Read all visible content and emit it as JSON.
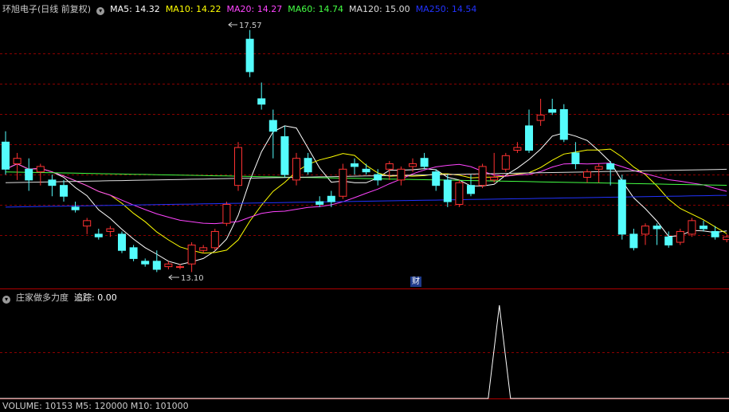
{
  "header": {
    "title": "环旭电子(日线 前复权)",
    "ma": [
      {
        "label": "MA5: 14.32",
        "color": "#ffffff"
      },
      {
        "label": "MA10: 14.22",
        "color": "#ffff00"
      },
      {
        "label": "MA20: 14.27",
        "color": "#ff44ff"
      },
      {
        "label": "MA60: 14.74",
        "color": "#44ff44"
      },
      {
        "label": "MA120: 15.00",
        "color": "#dddddd"
      },
      {
        "label": "MA250: 14.54",
        "color": "#2233ff"
      }
    ]
  },
  "annotations": {
    "high": "17.57",
    "low": "13.10",
    "finance_marker": "财"
  },
  "indicator": {
    "name": "庄家做多力度",
    "track_label": "追踪: 0.00"
  },
  "volume": {
    "label": "VOLUME: 10153  M5: 120000  M10: 101000"
  },
  "colors": {
    "up": "#ff3232",
    "down": "#54fcfc",
    "grid": "#8b0000",
    "frame": "#b00000"
  },
  "chart_data": {
    "type": "candlestick",
    "price_range": [
      12.9,
      17.8
    ],
    "ohlc": [
      [
        15.5,
        15.7,
        14.9,
        15.0
      ],
      [
        15.1,
        15.3,
        14.8,
        15.2
      ],
      [
        15.0,
        15.2,
        14.6,
        14.8
      ],
      [
        14.95,
        15.1,
        14.7,
        15.05
      ],
      [
        14.8,
        14.9,
        14.5,
        14.7
      ],
      [
        14.7,
        14.8,
        14.4,
        14.5
      ],
      [
        14.3,
        14.4,
        14.2,
        14.25
      ],
      [
        13.95,
        14.1,
        13.8,
        14.05
      ],
      [
        13.8,
        13.9,
        13.7,
        13.75
      ],
      [
        13.85,
        13.95,
        13.75,
        13.9
      ],
      [
        13.8,
        13.85,
        13.45,
        13.5
      ],
      [
        13.55,
        13.6,
        13.3,
        13.35
      ],
      [
        13.3,
        13.35,
        13.2,
        13.25
      ],
      [
        13.3,
        13.5,
        13.1,
        13.15
      ],
      [
        13.2,
        13.3,
        13.15,
        13.25
      ],
      [
        13.2,
        13.25,
        13.15,
        13.2
      ],
      [
        13.25,
        13.65,
        13.1,
        13.6
      ],
      [
        13.5,
        13.6,
        13.45,
        13.55
      ],
      [
        13.55,
        13.9,
        13.5,
        13.85
      ],
      [
        14.0,
        14.4,
        13.95,
        14.35
      ],
      [
        14.7,
        15.5,
        14.6,
        15.4
      ],
      [
        17.4,
        17.57,
        16.7,
        16.8
      ],
      [
        16.3,
        16.6,
        16.1,
        16.2
      ],
      [
        15.9,
        16.1,
        15.2,
        15.7
      ],
      [
        15.6,
        15.8,
        14.85,
        14.9
      ],
      [
        14.8,
        15.3,
        14.7,
        15.2
      ],
      [
        15.2,
        15.3,
        14.9,
        14.95
      ],
      [
        14.4,
        14.5,
        14.3,
        14.35
      ],
      [
        14.5,
        14.6,
        14.3,
        14.4
      ],
      [
        14.5,
        15.1,
        14.45,
        15.0
      ],
      [
        15.1,
        15.2,
        14.9,
        15.05
      ],
      [
        15.0,
        15.1,
        14.9,
        14.95
      ],
      [
        14.9,
        15.0,
        14.7,
        14.8
      ],
      [
        15.0,
        15.15,
        14.8,
        15.1
      ],
      [
        14.8,
        15.05,
        14.7,
        15.0
      ],
      [
        15.05,
        15.2,
        14.95,
        15.1
      ],
      [
        15.2,
        15.3,
        15.0,
        15.05
      ],
      [
        14.95,
        15.0,
        14.6,
        14.7
      ],
      [
        14.8,
        14.9,
        14.3,
        14.4
      ],
      [
        14.35,
        14.8,
        14.3,
        14.75
      ],
      [
        14.7,
        14.9,
        14.5,
        14.55
      ],
      [
        14.7,
        15.1,
        14.65,
        15.05
      ],
      [
        14.8,
        15.3,
        14.75,
        14.85
      ],
      [
        15.0,
        15.3,
        14.95,
        15.25
      ],
      [
        15.35,
        15.5,
        15.3,
        15.4
      ],
      [
        15.8,
        16.1,
        15.3,
        15.35
      ],
      [
        15.9,
        16.3,
        15.8,
        16.0
      ],
      [
        16.1,
        16.3,
        16.0,
        16.05
      ],
      [
        16.1,
        16.2,
        15.5,
        15.55
      ],
      [
        15.3,
        15.5,
        15.0,
        15.1
      ],
      [
        14.85,
        15.0,
        14.75,
        14.95
      ],
      [
        15.0,
        15.1,
        14.75,
        15.05
      ],
      [
        15.1,
        15.15,
        14.7,
        15.0
      ],
      [
        14.8,
        14.9,
        13.7,
        13.8
      ],
      [
        13.8,
        13.9,
        13.5,
        13.55
      ],
      [
        13.8,
        14.0,
        13.6,
        13.95
      ],
      [
        13.95,
        14.0,
        13.6,
        13.9
      ],
      [
        13.75,
        13.85,
        13.55,
        13.6
      ],
      [
        13.65,
        13.9,
        13.6,
        13.85
      ],
      [
        13.8,
        14.1,
        13.75,
        14.05
      ],
      [
        13.95,
        14.05,
        13.85,
        13.9
      ],
      [
        13.85,
        13.95,
        13.7,
        13.75
      ],
      [
        13.7,
        13.8,
        13.65,
        13.75
      ]
    ],
    "indicator_spike": {
      "position": 0.685,
      "max": 1
    }
  }
}
